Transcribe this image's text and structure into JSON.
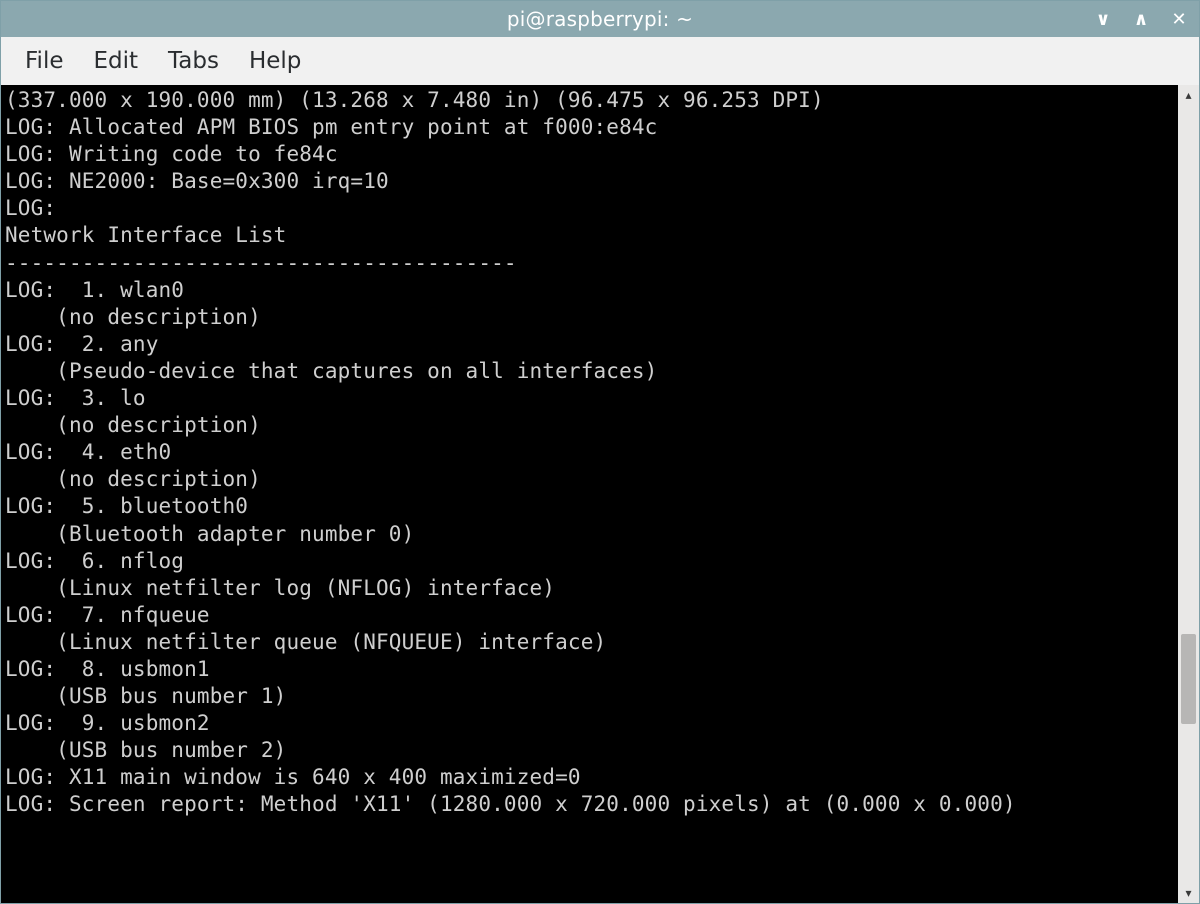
{
  "window": {
    "title": "pi@raspberrypi: ~"
  },
  "menu": {
    "items": [
      "File",
      "Edit",
      "Tabs",
      "Help"
    ]
  },
  "terminal": {
    "lines": [
      "(337.000 x 190.000 mm) (13.268 x 7.480 in) (96.475 x 96.253 DPI)",
      "LOG: Allocated APM BIOS pm entry point at f000:e84c",
      "LOG: Writing code to fe84c",
      "LOG: NE2000: Base=0x300 irq=10",
      "LOG:",
      "Network Interface List",
      "----------------------------------------",
      "LOG:  1. wlan0",
      "    (no description)",
      "LOG:  2. any",
      "    (Pseudo-device that captures on all interfaces)",
      "LOG:  3. lo",
      "    (no description)",
      "LOG:  4. eth0",
      "    (no description)",
      "LOG:  5. bluetooth0",
      "    (Bluetooth adapter number 0)",
      "LOG:  6. nflog",
      "    (Linux netfilter log (NFLOG) interface)",
      "LOG:  7. nfqueue",
      "    (Linux netfilter queue (NFQUEUE) interface)",
      "LOG:  8. usbmon1",
      "    (USB bus number 1)",
      "LOG:  9. usbmon2",
      "    (USB bus number 2)",
      "LOG: X11 main window is 640 x 400 maximized=0",
      "LOG: Screen report: Method 'X11' (1280.000 x 720.000 pixels) at (0.000 x 0.000)"
    ]
  },
  "controls": {
    "minimize_glyph": "∨",
    "maximize_glyph": "∧",
    "close_glyph": "✕",
    "scroll_up_glyph": "▴",
    "scroll_down_glyph": "▾"
  }
}
